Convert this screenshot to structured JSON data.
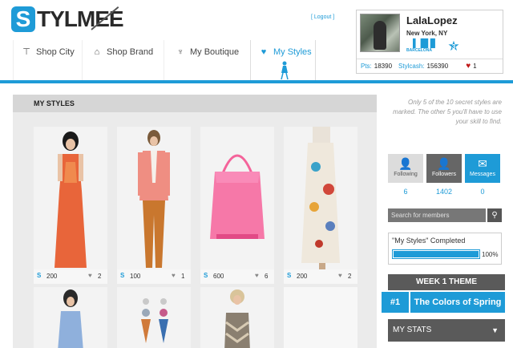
{
  "brand": {
    "logo_letter": "S",
    "logo_rest": "TYLMEE"
  },
  "header": {
    "logout": "[ Logout ]"
  },
  "nav": {
    "items": [
      {
        "label": "Shop City",
        "icon": "signpost-icon"
      },
      {
        "label": "Shop Brand",
        "icon": "hanger-icon"
      },
      {
        "label": "My Boutique",
        "icon": "pin-icon"
      },
      {
        "label": "My Styles",
        "icon": "heart-icon",
        "active": true
      }
    ]
  },
  "profile": {
    "name": "LalaLopez",
    "location": "New York, NY",
    "city_badge": "BARCELONA",
    "level": "3",
    "pts_label": "Pts:",
    "pts_value": "18390",
    "stylcash_label": "Stylcash:",
    "stylcash_value": "156390",
    "hearts": "1"
  },
  "main": {
    "title": "MY STYLES",
    "cards": [
      {
        "points": "200",
        "likes": "2"
      },
      {
        "points": "100",
        "likes": "1"
      },
      {
        "points": "600",
        "likes": "6"
      },
      {
        "points": "200",
        "likes": "2"
      }
    ],
    "points_icon": "S"
  },
  "sidebar": {
    "hint": "Only 5 of the 10 secret styles are marked. The other 5 you'll have to use your skill to find.",
    "social": [
      {
        "label": "Following",
        "value": "6"
      },
      {
        "label": "Followers",
        "value": "1402"
      },
      {
        "label": "Messages",
        "value": "0"
      }
    ],
    "search_placeholder": "Search for members",
    "progress_title": "\"My Styles\" Completed",
    "progress_pct_text": "100%",
    "progress_value": 1.0,
    "theme_header": "WEEK 1 THEME",
    "theme_number": "#1",
    "theme_name": "The Colors of Spring",
    "stats_label": "MY STATS"
  },
  "colors": {
    "accent": "#1e9bd7",
    "heart": "#c01818",
    "panel": "#ebebeb"
  }
}
